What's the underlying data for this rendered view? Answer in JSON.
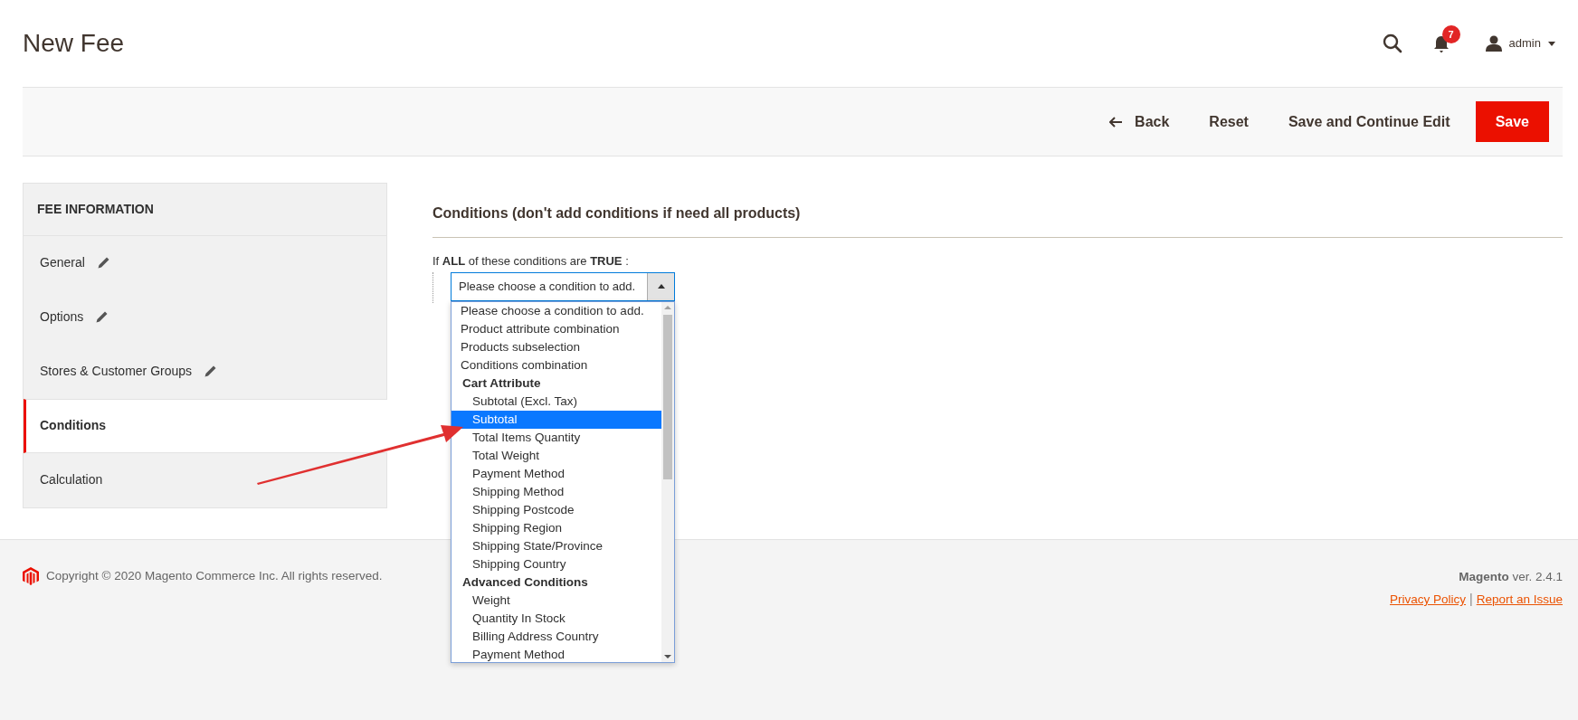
{
  "page": {
    "title": "New Fee"
  },
  "header": {
    "notification_count": "7",
    "user": "admin"
  },
  "actions": [
    {
      "label": "Back",
      "kind": "back"
    },
    {
      "label": "Reset",
      "kind": "plain"
    },
    {
      "label": "Save and Continue Edit",
      "kind": "plain"
    },
    {
      "label": "Save",
      "kind": "primary"
    }
  ],
  "sidebar": {
    "title": "FEE INFORMATION",
    "items": [
      {
        "label": "General",
        "edited": true,
        "selected": false
      },
      {
        "label": "Options",
        "edited": true,
        "selected": false
      },
      {
        "label": "Stores & Customer Groups",
        "edited": true,
        "selected": false
      },
      {
        "label": "Conditions",
        "edited": false,
        "selected": true
      },
      {
        "label": "Calculation",
        "edited": false,
        "selected": false
      }
    ]
  },
  "conditions": {
    "heading": "Conditions (don't add conditions if need all products)",
    "rule": "If **ALL**  of these conditions are **TRUE** :",
    "select": {
      "value": "Please choose a condition to add.",
      "expanded": true
    },
    "options": [
      {
        "kind": "option",
        "label": "Please choose a condition to add.",
        "selected": false
      },
      {
        "kind": "option",
        "label": "Product attribute combination",
        "selected": false
      },
      {
        "kind": "option",
        "label": "Products subselection",
        "selected": false
      },
      {
        "kind": "option",
        "label": "Conditions combination",
        "selected": false
      },
      {
        "kind": "group",
        "label": "Cart Attribute",
        "children": [
          {
            "label": "Subtotal (Excl. Tax)",
            "selected": false
          },
          {
            "label": "Subtotal",
            "selected": true
          },
          {
            "label": "Total Items Quantity",
            "selected": false
          },
          {
            "label": "Total Weight",
            "selected": false
          },
          {
            "label": "Payment Method",
            "selected": false
          },
          {
            "label": "Shipping Method",
            "selected": false
          },
          {
            "label": "Shipping Postcode",
            "selected": false
          },
          {
            "label": "Shipping Region",
            "selected": false
          },
          {
            "label": "Shipping State/Province",
            "selected": false
          },
          {
            "label": "Shipping Country",
            "selected": false
          }
        ]
      },
      {
        "kind": "group",
        "label": "Advanced Conditions",
        "children": [
          {
            "label": "Weight",
            "selected": false
          },
          {
            "label": "Quantity In Stock",
            "selected": false
          },
          {
            "label": "Billing Address Country",
            "selected": false
          },
          {
            "label": "Payment Method",
            "selected": false
          }
        ]
      }
    ]
  },
  "footer": {
    "copyright": "Copyright © 2020 Magento Commerce Inc. All rights reserved.",
    "version": "**Magento** ver. 2.4.1",
    "links": [
      "Privacy Policy",
      "Report an Issue"
    ],
    "link_separator": "|"
  }
}
